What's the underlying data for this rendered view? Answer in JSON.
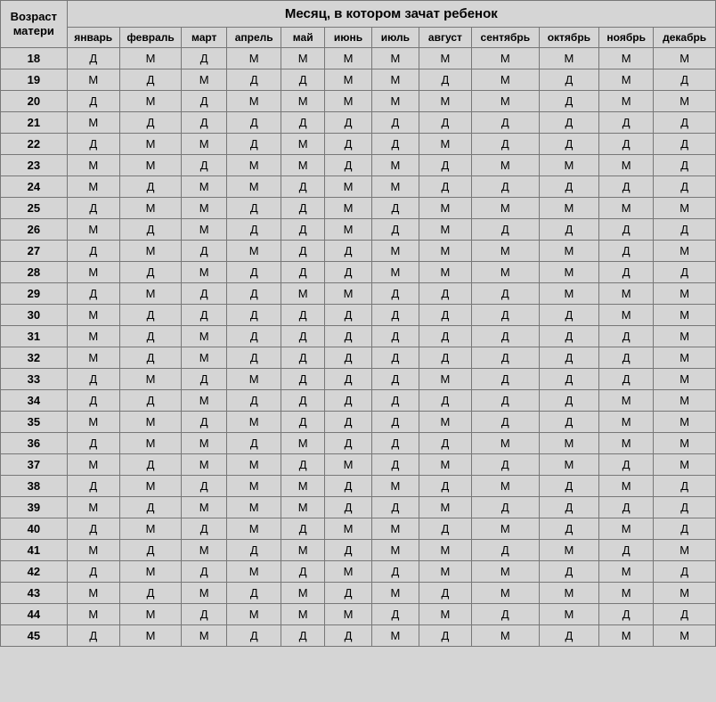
{
  "header": {
    "row_header": "Возраст матери",
    "super_header": "Месяц, в котором зачат ребенок"
  },
  "months": [
    "январь",
    "февраль",
    "март",
    "апрель",
    "май",
    "июнь",
    "июль",
    "август",
    "сентябрь",
    "октябрь",
    "ноябрь",
    "декабрь"
  ],
  "ages": [
    "18",
    "19",
    "20",
    "21",
    "22",
    "23",
    "24",
    "25",
    "26",
    "27",
    "28",
    "29",
    "30",
    "31",
    "32",
    "33",
    "34",
    "35",
    "36",
    "37",
    "38",
    "39",
    "40",
    "41",
    "42",
    "43",
    "44",
    "45"
  ],
  "rows": [
    [
      "Д",
      "М",
      "Д",
      "М",
      "М",
      "М",
      "М",
      "М",
      "М",
      "М",
      "М",
      "М"
    ],
    [
      "М",
      "Д",
      "М",
      "Д",
      "Д",
      "М",
      "М",
      "Д",
      "М",
      "Д",
      "М",
      "Д"
    ],
    [
      "Д",
      "М",
      "Д",
      "М",
      "М",
      "М",
      "М",
      "М",
      "М",
      "Д",
      "М",
      "М"
    ],
    [
      "М",
      "Д",
      "Д",
      "Д",
      "Д",
      "Д",
      "Д",
      "Д",
      "Д",
      "Д",
      "Д",
      "Д"
    ],
    [
      "Д",
      "М",
      "М",
      "Д",
      "М",
      "Д",
      "Д",
      "М",
      "Д",
      "Д",
      "Д",
      "Д"
    ],
    [
      "М",
      "М",
      "Д",
      "М",
      "М",
      "Д",
      "М",
      "Д",
      "М",
      "М",
      "М",
      "Д"
    ],
    [
      "М",
      "Д",
      "М",
      "М",
      "Д",
      "М",
      "М",
      "Д",
      "Д",
      "Д",
      "Д",
      "Д"
    ],
    [
      "Д",
      "М",
      "М",
      "Д",
      "Д",
      "М",
      "Д",
      "М",
      "М",
      "М",
      "М",
      "М"
    ],
    [
      "М",
      "Д",
      "М",
      "Д",
      "Д",
      "М",
      "Д",
      "М",
      "Д",
      "Д",
      "Д",
      "Д"
    ],
    [
      "Д",
      "М",
      "Д",
      "М",
      "Д",
      "Д",
      "М",
      "М",
      "М",
      "М",
      "Д",
      "М"
    ],
    [
      "М",
      "Д",
      "М",
      "Д",
      "Д",
      "Д",
      "М",
      "М",
      "М",
      "М",
      "Д",
      "Д"
    ],
    [
      "Д",
      "М",
      "Д",
      "Д",
      "М",
      "М",
      "Д",
      "Д",
      "Д",
      "М",
      "М",
      "М"
    ],
    [
      "М",
      "Д",
      "Д",
      "Д",
      "Д",
      "Д",
      "Д",
      "Д",
      "Д",
      "Д",
      "М",
      "М"
    ],
    [
      "М",
      "Д",
      "М",
      "Д",
      "Д",
      "Д",
      "Д",
      "Д",
      "Д",
      "Д",
      "Д",
      "М"
    ],
    [
      "М",
      "Д",
      "М",
      "Д",
      "Д",
      "Д",
      "Д",
      "Д",
      "Д",
      "Д",
      "Д",
      "М"
    ],
    [
      "Д",
      "М",
      "Д",
      "М",
      "Д",
      "Д",
      "Д",
      "М",
      "Д",
      "Д",
      "Д",
      "М"
    ],
    [
      "Д",
      "Д",
      "М",
      "Д",
      "Д",
      "Д",
      "Д",
      "Д",
      "Д",
      "Д",
      "М",
      "М"
    ],
    [
      "М",
      "М",
      "Д",
      "М",
      "Д",
      "Д",
      "Д",
      "М",
      "Д",
      "Д",
      "М",
      "М"
    ],
    [
      "Д",
      "М",
      "М",
      "Д",
      "М",
      "Д",
      "Д",
      "Д",
      "М",
      "М",
      "М",
      "М"
    ],
    [
      "М",
      "Д",
      "М",
      "М",
      "Д",
      "М",
      "Д",
      "М",
      "Д",
      "М",
      "Д",
      "М"
    ],
    [
      "Д",
      "М",
      "Д",
      "М",
      "М",
      "Д",
      "М",
      "Д",
      "М",
      "Д",
      "М",
      "Д"
    ],
    [
      "М",
      "Д",
      "М",
      "М",
      "М",
      "Д",
      "Д",
      "М",
      "Д",
      "Д",
      "Д",
      "Д"
    ],
    [
      "Д",
      "М",
      "Д",
      "М",
      "Д",
      "М",
      "М",
      "Д",
      "М",
      "Д",
      "М",
      "Д"
    ],
    [
      "М",
      "Д",
      "М",
      "Д",
      "М",
      "Д",
      "М",
      "М",
      "Д",
      "М",
      "Д",
      "М"
    ],
    [
      "Д",
      "М",
      "Д",
      "М",
      "Д",
      "М",
      "Д",
      "М",
      "М",
      "Д",
      "М",
      "Д"
    ],
    [
      "М",
      "Д",
      "М",
      "Д",
      "М",
      "Д",
      "М",
      "Д",
      "М",
      "М",
      "М",
      "М"
    ],
    [
      "М",
      "М",
      "Д",
      "М",
      "М",
      "М",
      "Д",
      "М",
      "Д",
      "М",
      "Д",
      "Д"
    ],
    [
      "Д",
      "М",
      "М",
      "Д",
      "Д",
      "Д",
      "М",
      "Д",
      "М",
      "Д",
      "М",
      "М"
    ]
  ]
}
